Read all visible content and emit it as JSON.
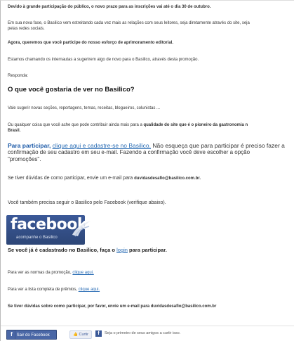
{
  "notice": "Devido à grande participação do público, o novo prazo para as inscrições vai até o dia 30 de outubro.",
  "intro": "Em sua nova fase, o Basilico vem estreitando cada vez mais as relações com seus leitores, seja diretamente através do site, seja",
  "intro2": "pelas redes sociais.",
  "agora": "Agora, queremos que você participe do nosso esforço de aprimoramento editorial.",
  "estamos": "Estamos chamando os internautas a sugerirem algo de novo para o Basilico, através desta promoção.",
  "responda": "Responda:",
  "question": "O que você gostaria de ver no Basilico?",
  "vale": "Vale sugerir novas seções, reportagens, temas, receitas, blogueiros, colunistas ...",
  "qualquer_pre": "Ou qualquer coisa que você ache que pode contribuir ainda mais para a ",
  "qualquer_bold": "qualidade do site que é o pioneiro da gastronomia n",
  "qualquer_end": "Brasil.",
  "participar_label": "Para participar,",
  "participar_link": "clique aqui e cadastre-se no Basilico.",
  "participar_rest": " Não esqueça que para participar é preciso fazer a",
  "participar_line2": "confirmação de seu cadastro em seu e-mail. Fazendo a confirmação você deve escolher a opção",
  "participar_line3": "\"promoções\".",
  "duvidas_pre": "Se tiver dúvidas de como participar, envie um e-mail para ",
  "duvidas_email": "duvidasdesafio@basilico.com.br.",
  "facebook_follow": "Você também precisa seguir o Basilico pelo Facebook (verifique abaixo).",
  "fb_logo_word": "facebook",
  "fb_logo_sub": "acompanhe o Basilico",
  "cadastrado_pre": "Se você já é cadastrado no Basilico, faça o ",
  "cadastrado_link": "login",
  "cadastrado_post": " para participar.",
  "normas_pre": "Para ver as normas da promoção, ",
  "normas_link": "clique aqui.",
  "premios_pre": "Para ver a lista completa de prêmios, ",
  "premios_link": "clique aqui.",
  "duvidas2": "Se tiver dúvidas sobre como participar, por favor, envie um e-mail para duvidasdesafio@basilico.com.br",
  "footer": {
    "sair_label": "Sair do Facebook",
    "curtir_label": "Curtir",
    "friends_text": "Seja o primeiro de seus amigos a curtir isso."
  },
  "colors": {
    "link": "#2a6db5",
    "facebook_blue": "#3b5998"
  }
}
